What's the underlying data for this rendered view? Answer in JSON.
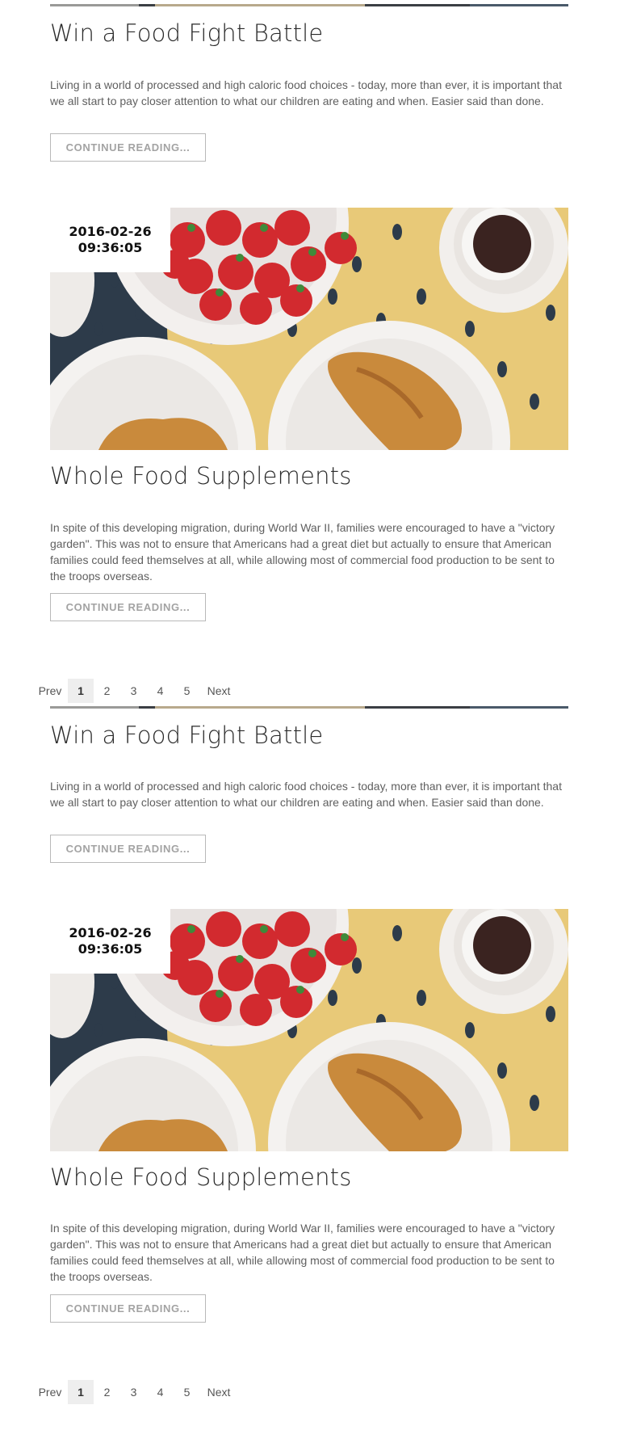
{
  "pagination": {
    "prev": "Prev",
    "pages": [
      "1",
      "2",
      "3",
      "4",
      "5"
    ],
    "current": "1",
    "next": "Next"
  },
  "post_battle": {
    "title": "Win a Food Fight Battle",
    "excerpt": "Living in a world of processed and high caloric food choices - today, more than ever, it is important that we all start to pay closer attention to what our children are eating and when. Easier said than done.",
    "button": "CONTINUE READING..."
  },
  "post_supplements": {
    "date": "2016-02-26",
    "time": "09:36:05",
    "image": "strawberries-croissants-coffee-photo",
    "title": "Whole Food Supplements",
    "excerpt": "In spite of this developing migration, during World War II, families were encouraged to have a \"victory garden\". This was not to ensure that Americans had a great diet but actually to ensure that American families could feed themselves at all, while allowing most of commercial food production to be sent to the troops overseas.",
    "button": "CONTINUE READING..."
  },
  "colors": {
    "title": "#2a2a2a",
    "body_text": "#5f5f5f",
    "button_border": "#b9b9b9",
    "button_text": "#a3a3a3",
    "placemat": "#e8c978",
    "table": "#2d3b4a"
  }
}
